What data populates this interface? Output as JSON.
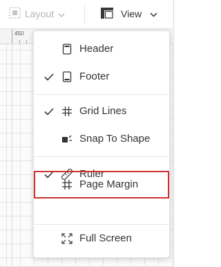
{
  "toolbar": {
    "layout_label": "Layout",
    "view_label": "View"
  },
  "ruler": {
    "number": "450"
  },
  "menu": {
    "items": [
      {
        "label": "Header",
        "checked": false,
        "icon": "header-icon"
      },
      {
        "label": "Footer",
        "checked": true,
        "icon": "footer-icon"
      },
      {
        "label": "Grid Lines",
        "checked": true,
        "icon": "grid-icon"
      },
      {
        "label": "Snap To Shape",
        "checked": false,
        "icon": "snap-icon"
      },
      {
        "label": "Ruler",
        "checked": true,
        "icon": "ruler-icon"
      },
      {
        "label": "Page Margin",
        "checked": false,
        "icon": "page-margin-icon",
        "highlighted": true
      },
      {
        "label": "Full Screen",
        "checked": false,
        "icon": "full-screen-icon"
      }
    ]
  },
  "colors": {
    "highlight_border": "#d32f2f",
    "disabled_text": "#b5b5b5"
  }
}
